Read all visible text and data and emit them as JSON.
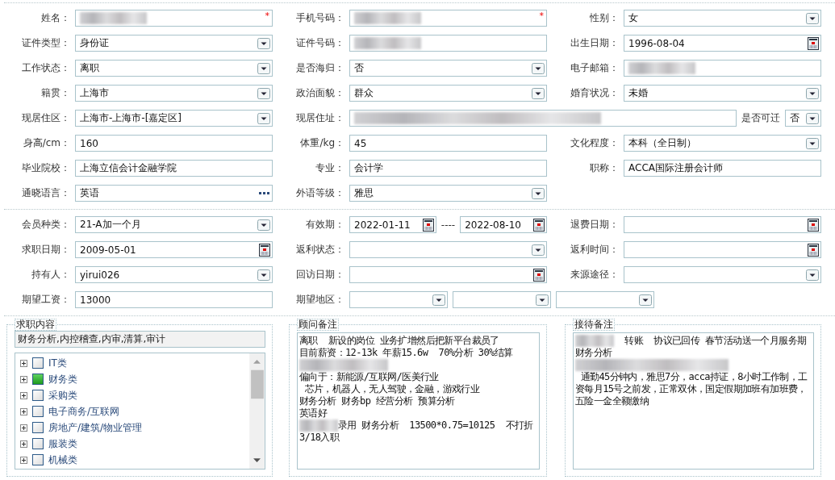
{
  "sections": [
    {
      "rows": [
        {
          "cells": [
            {
              "label": "姓名：",
              "controls": [
                {
                  "kind": "text",
                  "blurred": true,
                  "mark": "*"
                }
              ]
            },
            {
              "label": "手机号码：",
              "controls": [
                {
                  "kind": "text",
                  "blurred": true,
                  "mark": "*"
                }
              ]
            },
            {
              "label": "性别：",
              "controls": [
                {
                  "kind": "select",
                  "value": "女"
                }
              ]
            }
          ]
        },
        {
          "cells": [
            {
              "label": "证件类型：",
              "controls": [
                {
                  "kind": "select",
                  "value": "身份证"
                }
              ]
            },
            {
              "label": "证件号码：",
              "controls": [
                {
                  "kind": "text",
                  "blurred": true
                }
              ]
            },
            {
              "label": "出生日期：",
              "controls": [
                {
                  "kind": "date",
                  "value": "1996-08-04"
                }
              ]
            }
          ]
        },
        {
          "cells": [
            {
              "label": "工作状态：",
              "controls": [
                {
                  "kind": "select",
                  "value": "离职"
                }
              ]
            },
            {
              "label": "是否海归：",
              "controls": [
                {
                  "kind": "select",
                  "value": "否"
                }
              ]
            },
            {
              "label": "电子邮箱：",
              "controls": [
                {
                  "kind": "text",
                  "blurred": true
                }
              ]
            }
          ]
        },
        {
          "cells": [
            {
              "label": "籍贯：",
              "controls": [
                {
                  "kind": "select",
                  "value": "上海市"
                }
              ]
            },
            {
              "label": "政治面貌：",
              "controls": [
                {
                  "kind": "select",
                  "value": "群众"
                }
              ]
            },
            {
              "label": "婚育状况：",
              "controls": [
                {
                  "kind": "select",
                  "value": "未婚"
                }
              ]
            }
          ]
        },
        {
          "cells": [
            {
              "label": "现居住区：",
              "controls": [
                {
                  "kind": "select",
                  "value": "上海市-上海市-[嘉定区]"
                }
              ]
            },
            {
              "label": "现居住址：",
              "controls": [
                {
                  "kind": "text",
                  "blurred": true,
                  "wide": true
                },
                {
                  "kind": "label",
                  "value": "是否可迁"
                },
                {
                  "kind": "mini-select",
                  "value": "否"
                }
              ]
            }
          ]
        },
        {
          "cells": [
            {
              "label": "身高/cm：",
              "controls": [
                {
                  "kind": "text",
                  "value": "160"
                }
              ]
            },
            {
              "label": "体重/kg：",
              "controls": [
                {
                  "kind": "text",
                  "value": "45"
                }
              ]
            },
            {
              "label": "文化程度：",
              "controls": [
                {
                  "kind": "select",
                  "value": "本科（全日制）"
                }
              ]
            }
          ]
        },
        {
          "cells": [
            {
              "label": "毕业院校：",
              "controls": [
                {
                  "kind": "text",
                  "value": "上海立信会计金融学院"
                }
              ]
            },
            {
              "label": "专业：",
              "controls": [
                {
                  "kind": "text",
                  "value": "会计学"
                }
              ]
            },
            {
              "label": "职称：",
              "controls": [
                {
                  "kind": "text",
                  "value": "ACCA国际注册会计师"
                }
              ]
            }
          ]
        },
        {
          "cells": [
            {
              "label": "通晓语言：",
              "controls": [
                {
                  "kind": "more",
                  "value": "英语"
                }
              ]
            },
            {
              "label": "外语等级：",
              "controls": [
                {
                  "kind": "select",
                  "value": "雅思"
                }
              ]
            }
          ]
        }
      ]
    },
    {
      "rows": [
        {
          "cells": [
            {
              "label": "会员种类：",
              "controls": [
                {
                  "kind": "select",
                  "value": "21-A加一个月"
                }
              ]
            },
            {
              "label": "有效期：",
              "controls": [
                {
                  "kind": "date",
                  "value": "2022-01-11"
                },
                {
                  "kind": "dash",
                  "value": "----"
                },
                {
                  "kind": "date",
                  "value": "2022-08-10"
                }
              ]
            },
            {
              "label": "退费日期：",
              "controls": [
                {
                  "kind": "date"
                }
              ]
            }
          ]
        },
        {
          "cells": [
            {
              "label": "求职日期：",
              "controls": [
                {
                  "kind": "date",
                  "value": "2009-05-01"
                }
              ]
            },
            {
              "label": "返利状态：",
              "controls": [
                {
                  "kind": "select"
                }
              ]
            },
            {
              "label": "返利时间：",
              "controls": [
                {
                  "kind": "date"
                }
              ]
            }
          ]
        },
        {
          "cells": [
            {
              "label": "持有人：",
              "controls": [
                {
                  "kind": "select",
                  "value": "yirui026"
                }
              ]
            },
            {
              "label": "回访日期：",
              "controls": [
                {
                  "kind": "date"
                }
              ]
            },
            {
              "label": "来源途径：",
              "controls": [
                {
                  "kind": "select"
                }
              ]
            }
          ]
        },
        {
          "cells": [
            {
              "label": "期望工资：",
              "controls": [
                {
                  "kind": "text",
                  "value": "13000"
                }
              ]
            },
            {
              "label": "期望地区：",
              "controls": [
                {
                  "kind": "short-select"
                },
                {
                  "kind": "short-select"
                },
                {
                  "kind": "short-select"
                }
              ]
            }
          ]
        }
      ]
    }
  ],
  "job_content": {
    "title": "求职内容",
    "summary": "财务分析,内控稽查,内审,清算,审计",
    "tree": [
      {
        "label": "IT类",
        "checked": false
      },
      {
        "label": "财务类",
        "checked": true
      },
      {
        "label": "采购类",
        "checked": false
      },
      {
        "label": "电子商务/互联网",
        "checked": false
      },
      {
        "label": "房地产/建筑/物业管理",
        "checked": false
      },
      {
        "label": "服装类",
        "checked": false
      },
      {
        "label": "机械类",
        "checked": false
      }
    ]
  },
  "notes": [
    {
      "title": "顾问备注",
      "paragraphs": [
        [
          {
            "text": "离职  新设的岗位 业务扩增然后把新平台裁员了"
          }
        ],
        [
          {
            "text": "目前薪资：12-13k 年薪15.6w  70%分析 30%结算"
          }
        ],
        [
          {
            "blur": true
          }
        ],
        [
          {
            "text": "偏向于：新能源/互联网/医美行业"
          }
        ],
        [
          {
            "text": " 芯片，机器人，无人驾驶，金融，游戏行业"
          }
        ],
        [
          {
            "text": "财务分析 财务bp 经营分析 预算分析"
          }
        ],
        [
          {
            "text": "英语好"
          }
        ],
        [
          {
            "blur": true
          },
          {
            "text": "录用 财务分析  13500*0.75=10125  不打折"
          }
        ],
        [
          {
            "text": "3/18入职"
          }
        ]
      ]
    },
    {
      "title": "接待备注",
      "paragraphs": [
        [
          {
            "blur": true
          },
          {
            "text": "  转账  协议已回传 春节活动送一个月服务期"
          }
        ],
        [
          {
            "text": "财务分析"
          }
        ],
        [
          {
            "blur": true
          },
          {
            "text": " 通勤45分钟内，雅思7分，acca持证，8小时工作制，工资每月15号之前发，正常双休，国定假期加班有加班费，五险一金全额缴纳"
          }
        ]
      ]
    }
  ]
}
